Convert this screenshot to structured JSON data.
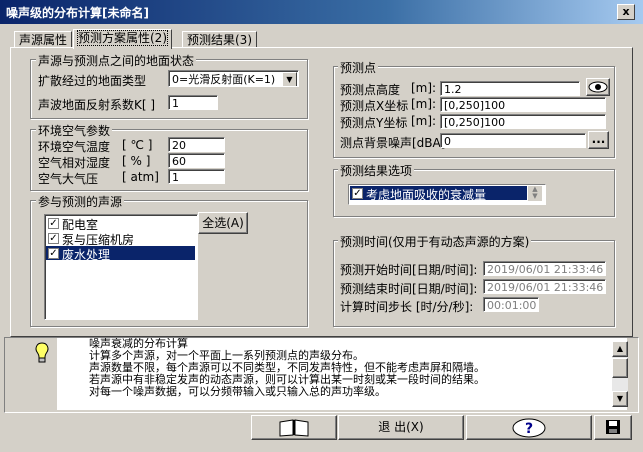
{
  "window": {
    "title": "噪声级的分布计算[未命名]",
    "close_label": "x"
  },
  "tabs": [
    {
      "label": "声源属性"
    },
    {
      "label": "预测方案属性(2)"
    },
    {
      "label": "预测结果(3)"
    }
  ],
  "ground": {
    "title": "声源与预测点之间的地面状态",
    "type_label": "扩散经过的地面类型",
    "type_value": "0=光滑反射面(K=1)",
    "reflect_label": "声波地面反射系数K[ ]",
    "reflect_value": "1"
  },
  "env": {
    "title": "环境空气参数",
    "rows": [
      {
        "label": "环境空气温度",
        "unit": "[ ℃ ]",
        "value": "20"
      },
      {
        "label": "空气相对湿度",
        "unit": "[ % ]",
        "value": "60"
      },
      {
        "label": "空气大气压",
        "unit": "[ atm]",
        "value": "1"
      }
    ]
  },
  "sources": {
    "title": "参与预测的声源",
    "select_all": "全选(A)",
    "items": [
      "配电室",
      "泵与压缩机房",
      "废水处理"
    ]
  },
  "point": {
    "title": "预测点",
    "rows": [
      {
        "label": "预测点高度",
        "unit": "[m]:",
        "value": "1.2"
      },
      {
        "label": "预测点X坐标",
        "unit": "[m]:",
        "value": "[0,250]100"
      },
      {
        "label": "预测点Y坐标",
        "unit": "[m]:",
        "value": "[0,250]100"
      }
    ],
    "bg_label": "测点背景噪声[dBA]",
    "bg_value": "0",
    "bg_button": "..."
  },
  "result_options": {
    "title": "预测结果选项",
    "item": "考虑地面吸收的衰减量"
  },
  "time": {
    "title": "预测时间(仅用于有动态声源的方案)",
    "rows": [
      {
        "label": "预测开始时间[日期/时间]:",
        "value": "2019/06/01  21:33:46"
      },
      {
        "label": "预测结束时间[日期/时间]:",
        "value": "2019/06/01  21:33:46"
      },
      {
        "label": "计算时间步长 [时/分/秒]:",
        "value": "00:01:00"
      }
    ]
  },
  "info": {
    "lines": [
      "噪声衰减的分布计算",
      "计算多个声源，对一个平面上一系列预测点的声级分布。",
      "声源数量不限，每个声源可以不同类型，不同发声特性，但不能考虑声屏和隔墙。",
      "若声源中有非稳定发声的动态声源，则可以计算出某一时刻或某一段时间的结果。",
      "对每一个噪声数据，可以分频带输入或只输入总的声功率级。"
    ]
  },
  "bottom": {
    "exit_label": "退 出(X)",
    "help_label": "?"
  }
}
